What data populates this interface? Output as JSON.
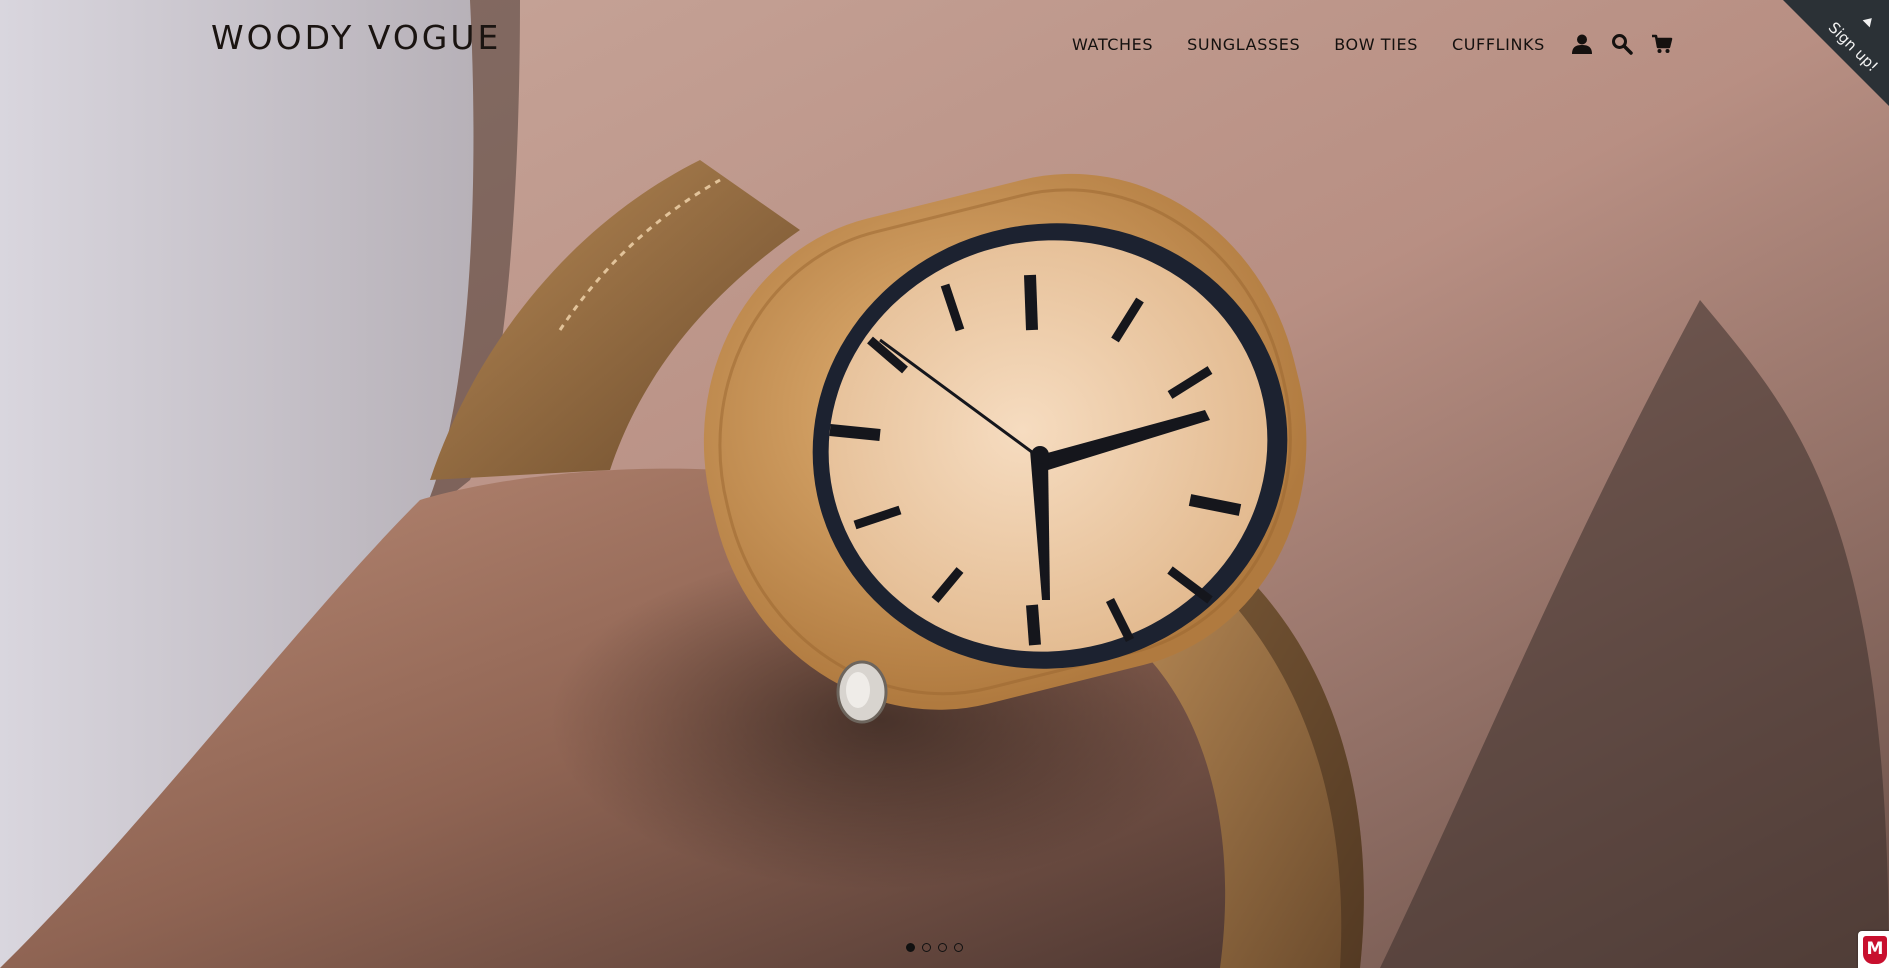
{
  "brand": {
    "name": "WOODY VOGUE"
  },
  "nav": {
    "links": [
      {
        "label": "WATCHES"
      },
      {
        "label": "SUNGLASSES"
      },
      {
        "label": "BOW TIES"
      },
      {
        "label": "CUFFLINKS"
      }
    ],
    "icons": [
      "account-icon",
      "search-icon",
      "cart-icon"
    ]
  },
  "signup": {
    "label": "Sign up!"
  },
  "slider": {
    "slide_count": 4,
    "active_index": 0
  },
  "badge": {
    "letter": "M"
  },
  "colors": {
    "text": "#15110f",
    "ribbon": "#2b3136",
    "badge_red": "#c8102e"
  }
}
